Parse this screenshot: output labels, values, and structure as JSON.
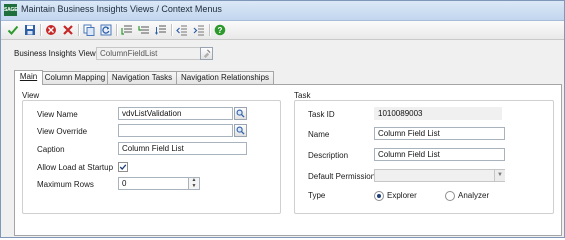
{
  "window": {
    "app_icon_text": "SAGE",
    "title": "Maintain Business Insights Views / Context Menus"
  },
  "toolbar": {
    "buttons": [
      {
        "name": "accept",
        "icon": "check-icon",
        "color": "#2e9a2e"
      },
      {
        "name": "save",
        "icon": "save-icon",
        "color": "#2d5fa8"
      },
      {
        "name": "delete",
        "icon": "delete-icon",
        "color": "#c62828"
      },
      {
        "name": "cancel",
        "icon": "cancel-icon",
        "color": "#c62828"
      },
      {
        "name": "copy",
        "icon": "copy-icon",
        "color": "#4a78b8"
      },
      {
        "name": "refresh",
        "icon": "refresh-icon",
        "color": "#4a78b8"
      },
      {
        "name": "insert-above",
        "icon": "insert-above-icon",
        "color": "#666666"
      },
      {
        "name": "insert-below",
        "icon": "insert-below-icon",
        "color": "#666666"
      },
      {
        "name": "move-down",
        "icon": "move-down-icon",
        "color": "#666666"
      },
      {
        "name": "outdent",
        "icon": "outdent-icon",
        "color": "#666666"
      },
      {
        "name": "indent",
        "icon": "indent-icon",
        "color": "#666666"
      },
      {
        "name": "help",
        "icon": "help-icon",
        "color": "#2e9a2e"
      }
    ]
  },
  "header": {
    "view_label": "Business Insights View",
    "view_value": "ColumnFieldList"
  },
  "tabs": [
    {
      "label": "Main",
      "active": true
    },
    {
      "label": "Column Mapping",
      "active": false
    },
    {
      "label": "Navigation Tasks",
      "active": false
    },
    {
      "label": "Navigation Relationships",
      "active": false
    }
  ],
  "view_group": {
    "title": "View",
    "view_name_label": "View Name",
    "view_name_value": "vdvListValidation",
    "view_override_label": "View Override",
    "view_override_value": "",
    "caption_label": "Caption",
    "caption_value": "Column Field List",
    "allow_load_label": "Allow Load at Startup",
    "allow_load_checked": true,
    "max_rows_label": "Maximum Rows",
    "max_rows_value": "0"
  },
  "task_group": {
    "title": "Task",
    "task_id_label": "Task ID",
    "task_id_value": "1010089003",
    "name_label": "Name",
    "name_value": "Column Field List",
    "description_label": "Description",
    "description_value": "Column Field List",
    "default_permission_label": "Default Permission",
    "default_permission_value": "",
    "type_label": "Type",
    "type_options": [
      {
        "label": "Explorer",
        "selected": true
      },
      {
        "label": "Analyzer",
        "selected": false
      }
    ]
  }
}
